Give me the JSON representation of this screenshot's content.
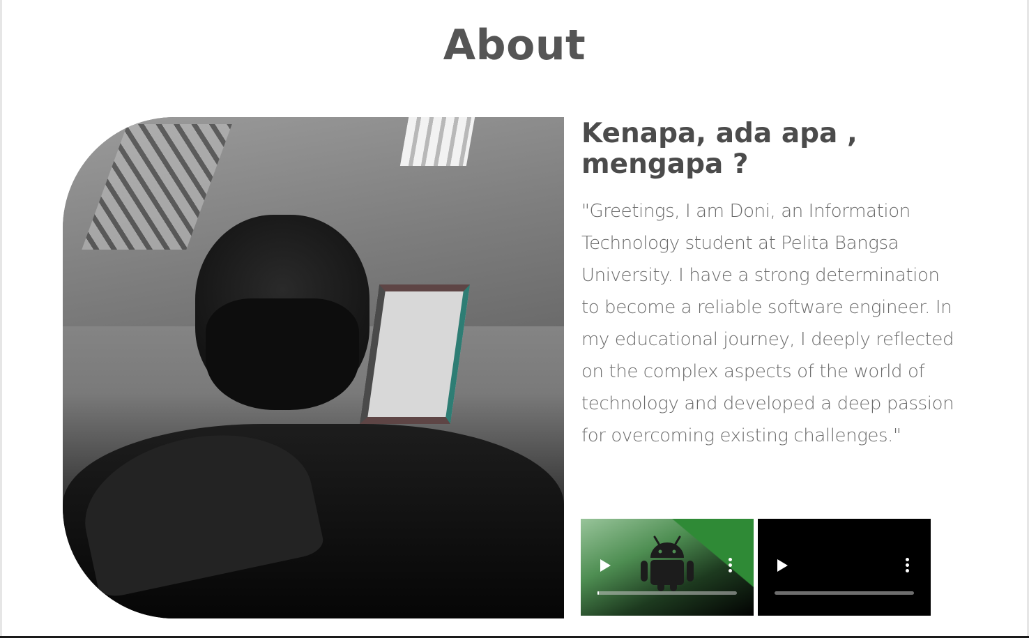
{
  "section": {
    "title": "About"
  },
  "profile": {
    "photo_alt": "profile-photo"
  },
  "about": {
    "heading": "Kenapa, ada apa , mengapa ?",
    "bio": "\"Greetings, I am Doni, an Information Technology student at Pelita Bangsa University. I have a strong determination to become a reliable software engineer. In my educational journey, I deeply reflected on the complex aspects of the world of technology and developed a deep passion for overcoming existing challenges.\""
  },
  "videos": [
    {
      "poster_icon": "android-icon",
      "progress": 0.0
    },
    {
      "poster_icon": "",
      "progress": 0.0
    }
  ],
  "colors": {
    "heading": "#555555",
    "body_text": "#6a6a6a",
    "android_green": "#2f8a36"
  }
}
